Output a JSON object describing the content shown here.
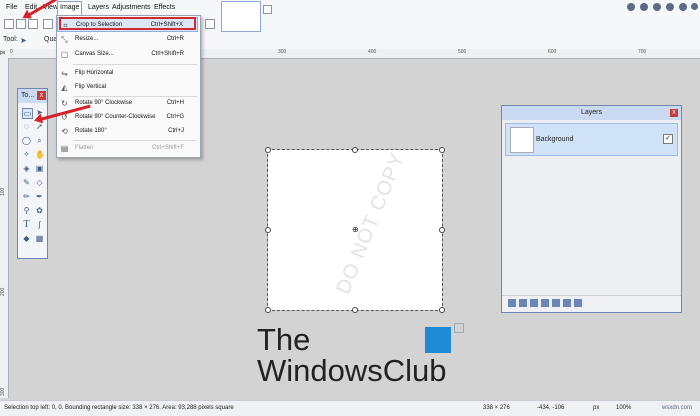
{
  "menubar": {
    "items": [
      "File",
      "Edit",
      "View",
      "Image",
      "Layers",
      "Adjustments",
      "Effects"
    ]
  },
  "toolbar2": {
    "tool_label": "Tool:",
    "quality_label": "Qua"
  },
  "image_menu": {
    "items": [
      {
        "label": "Crop to Selection",
        "shortcut": "Ctrl+Shift+X",
        "icon": "crop-icon",
        "highlighted": true
      },
      {
        "label": "Resize...",
        "shortcut": "Ctrl+R",
        "icon": "resize-icon"
      },
      {
        "label": "Canvas Size...",
        "shortcut": "Ctrl+Shift+R",
        "icon": "canvas-size-icon"
      },
      {
        "label": "Flip Horizontal",
        "shortcut": "",
        "icon": "flip-horizontal-icon"
      },
      {
        "label": "Flip Vertical",
        "shortcut": "",
        "icon": "flip-vertical-icon"
      },
      {
        "label": "Rotate 90° Clockwise",
        "shortcut": "Ctrl+H",
        "icon": "rotate-cw-icon"
      },
      {
        "label": "Rotate 90° Counter-Clockwise",
        "shortcut": "Ctrl+G",
        "icon": "rotate-ccw-icon"
      },
      {
        "label": "Rotate 180°",
        "shortcut": "Ctrl+J",
        "icon": "rotate-180-icon"
      },
      {
        "label": "Flatten",
        "shortcut": "Ctrl+Shift+F",
        "icon": "flatten-icon",
        "disabled": true
      }
    ]
  },
  "tools_panel": {
    "title": "To...",
    "close": "x"
  },
  "layers_panel": {
    "title": "Layers",
    "close": "x",
    "layer_name": "Background",
    "check": "✓"
  },
  "canvas": {
    "watermark": "DO NOT COPY"
  },
  "ruler": {
    "top_ticks": [
      "0",
      "100",
      "200",
      "300",
      "400",
      "500",
      "600",
      "700",
      "800"
    ],
    "left_ticks": [
      "100",
      "200",
      "300"
    ]
  },
  "logo": {
    "line1": "The",
    "line2": "WindowsClub"
  },
  "statusbar": {
    "selection_info": "Selection top left: 0, 0. Bounding rectangle size: 338 × 276. Area: 93,288 pixels square",
    "size": "338 × 276",
    "coords": "-434, -106",
    "unit": "px",
    "zoom": "100%"
  },
  "watermark_site": "wsxdn.com",
  "colors": {
    "accent": "#c9daf2",
    "annotation_red": "#d6212a"
  }
}
